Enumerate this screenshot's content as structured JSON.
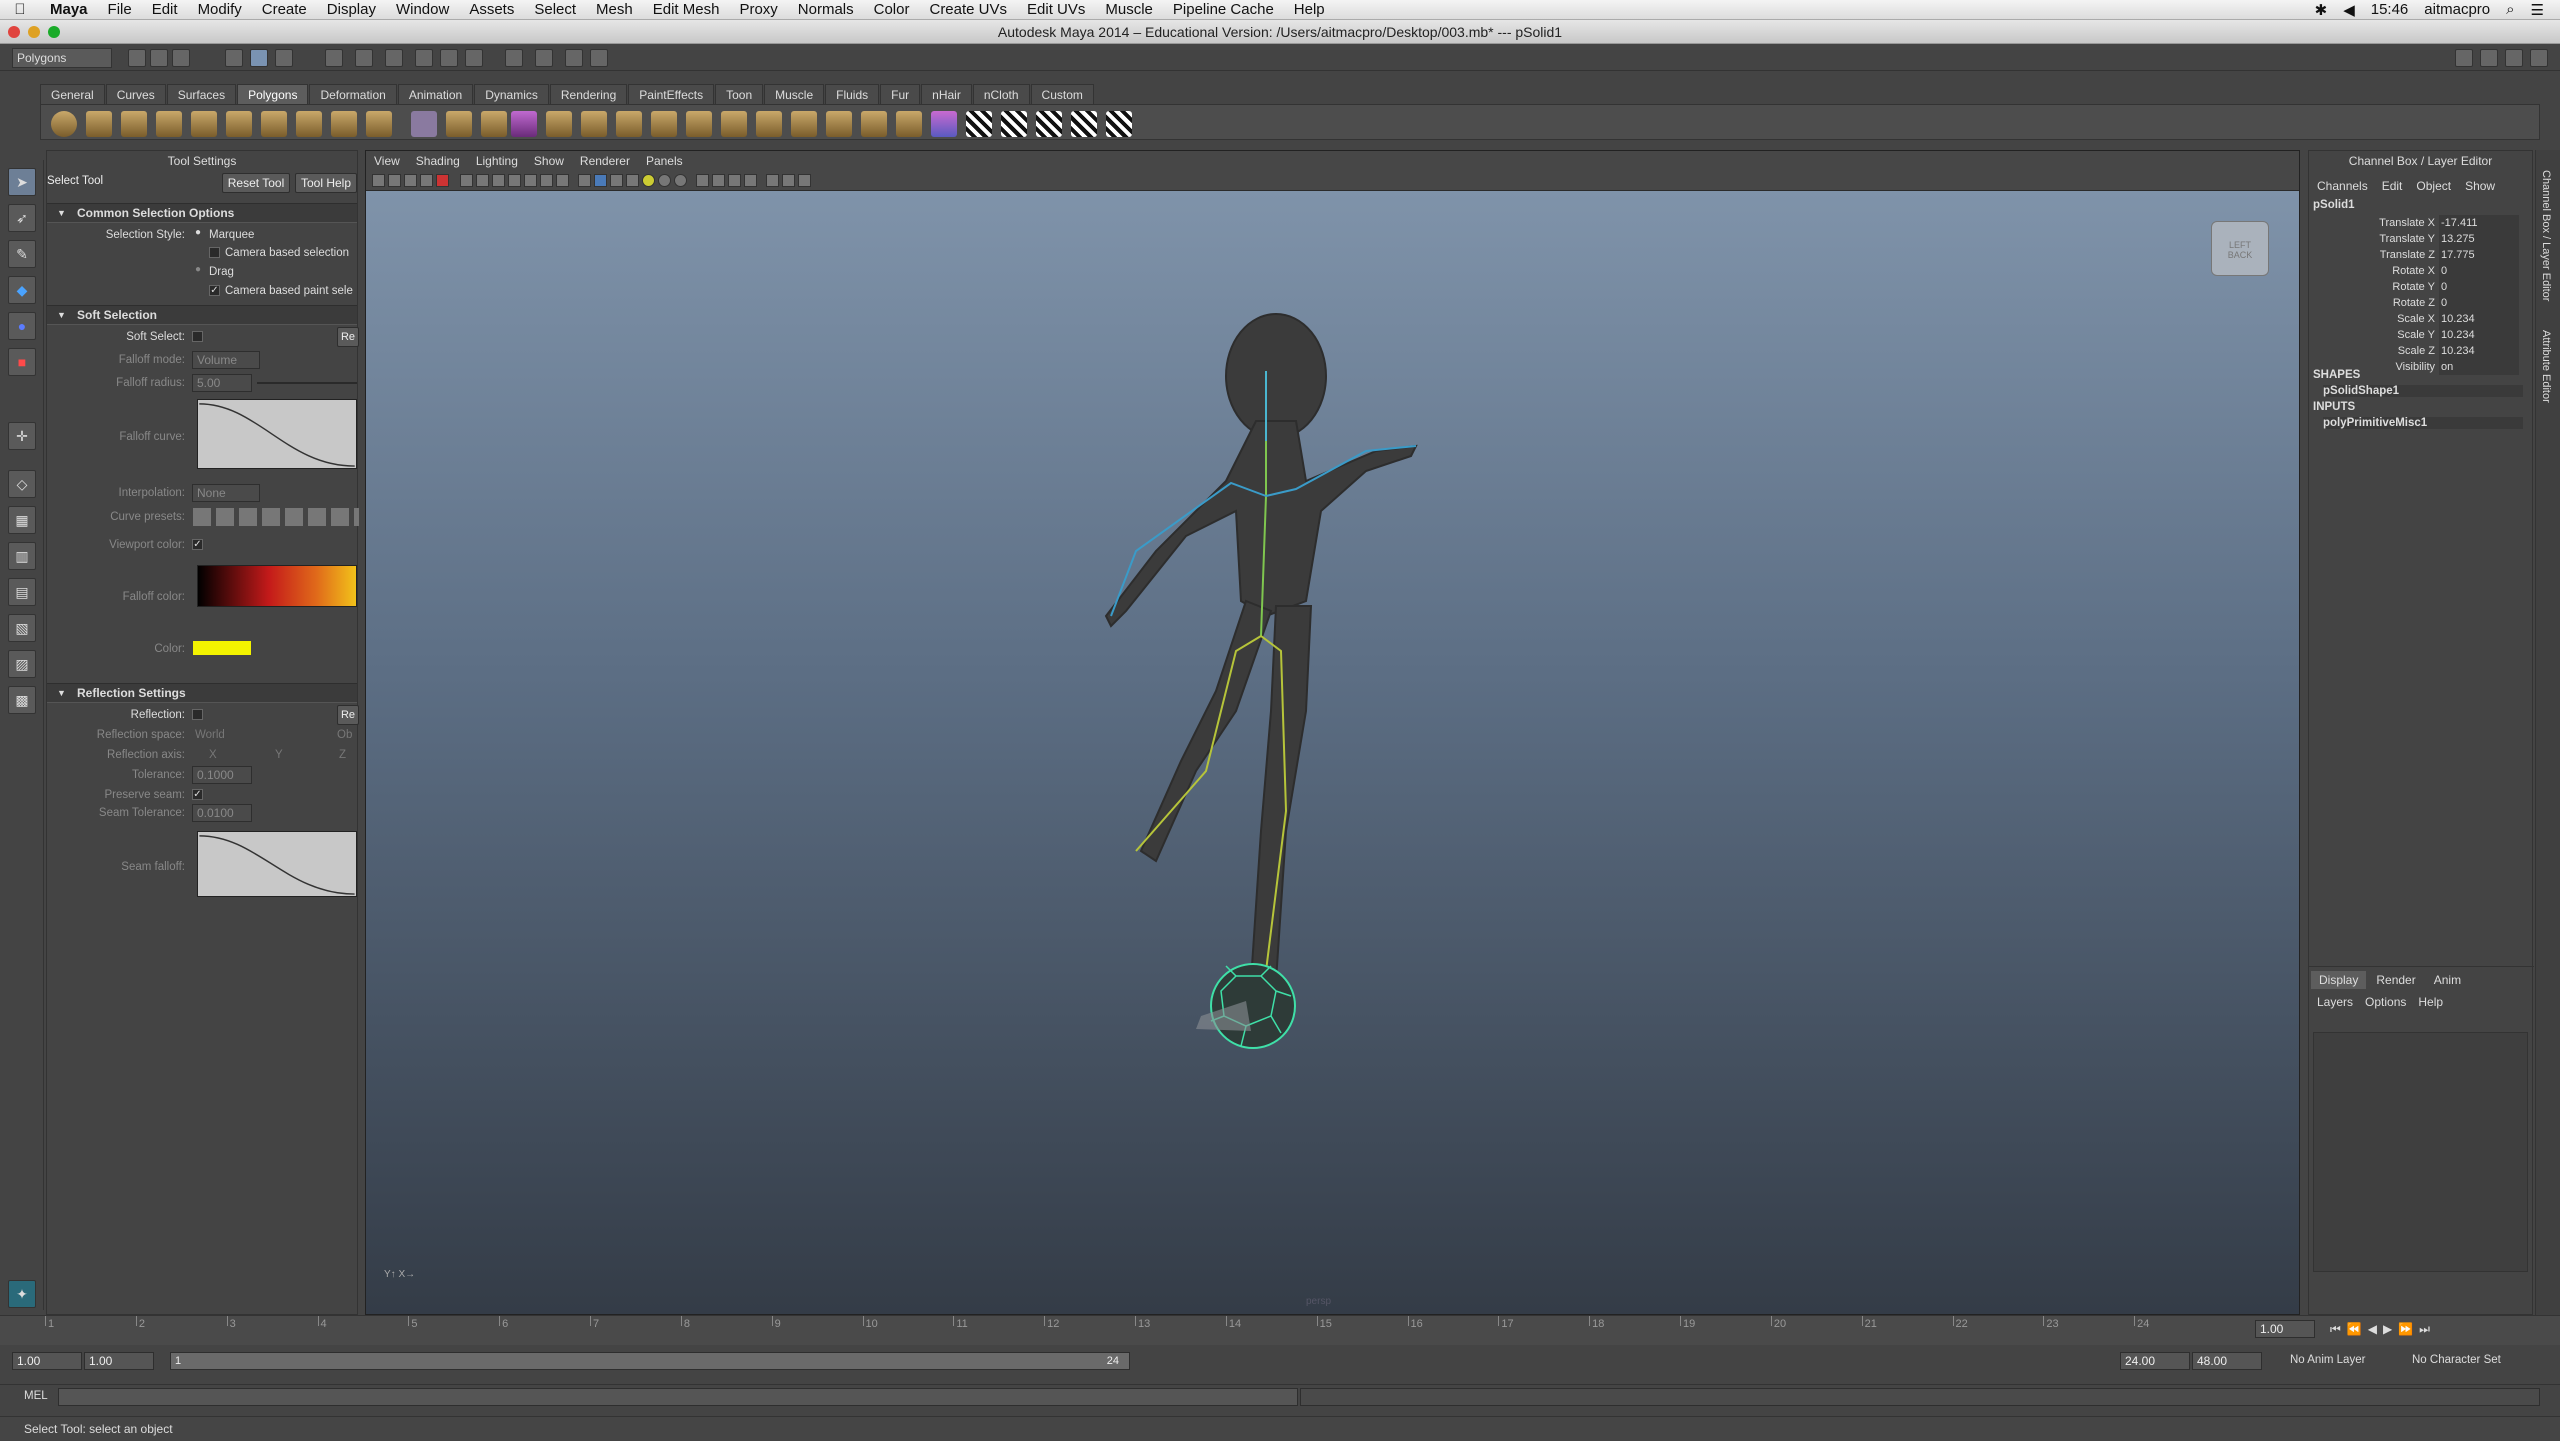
{
  "menubar": {
    "app": "Maya",
    "items": [
      "File",
      "Edit",
      "Modify",
      "Create",
      "Display",
      "Window",
      "Assets",
      "Select",
      "Mesh",
      "Edit Mesh",
      "Proxy",
      "Normals",
      "Color",
      "Create UVs",
      "Edit UVs",
      "Muscle",
      "Pipeline Cache",
      "Help"
    ],
    "clock": "15:46",
    "user": "aitmacpro"
  },
  "window": {
    "title": "Autodesk Maya 2014 – Educational Version: /Users/aitmacpro/Desktop/003.mb*  ---  pSolid1"
  },
  "status_line": {
    "mode": "Polygons"
  },
  "shelf": {
    "tabs": [
      "General",
      "Curves",
      "Surfaces",
      "Polygons",
      "Deformation",
      "Animation",
      "Dynamics",
      "Rendering",
      "PaintEffects",
      "Toon",
      "Muscle",
      "Fluids",
      "Fur",
      "nHair",
      "nCloth",
      "Custom"
    ],
    "active_tab": "Polygons"
  },
  "tool_settings": {
    "panel_title": "Tool Settings",
    "tool_name": "Select Tool",
    "reset_button": "Reset Tool",
    "help_button": "Tool Help",
    "common": {
      "header": "Common Selection Options",
      "style_label": "Selection Style:",
      "marquee": "Marquee",
      "camera_based_selection": "Camera based selection",
      "drag": "Drag",
      "camera_based_paint": "Camera based paint sele"
    },
    "soft": {
      "header": "Soft Selection",
      "soft_select_label": "Soft Select:",
      "reset_short": "Re",
      "falloff_mode_label": "Falloff mode:",
      "falloff_mode_value": "Volume",
      "falloff_radius_label": "Falloff radius:",
      "falloff_radius_value": "5.00",
      "falloff_curve_label": "Falloff curve:",
      "interpolation_label": "Interpolation:",
      "interpolation_value": "None",
      "curve_presets_label": "Curve presets:",
      "viewport_color_label": "Viewport color:",
      "falloff_color_label": "Falloff color:",
      "color_label": "Color:"
    },
    "reflection": {
      "header": "Reflection Settings",
      "reflection_label": "Reflection:",
      "reset_short": "Re",
      "space_label": "Reflection space:",
      "space_world": "World",
      "space_object": "Ob",
      "axis_label": "Reflection axis:",
      "axis_x": "X",
      "axis_y": "Y",
      "axis_z": "Z",
      "tolerance_label": "Tolerance:",
      "tolerance_value": "0.1000",
      "preserve_label": "Preserve seam:",
      "seam_tol_label": "Seam Tolerance:",
      "seam_tol_value": "0.0100",
      "seam_falloff_label": "Seam falloff:"
    }
  },
  "viewport": {
    "menu": [
      "View",
      "Shading",
      "Lighting",
      "Show",
      "Renderer",
      "Panels"
    ],
    "viewcube_left": "LEFT",
    "viewcube_back": "BACK",
    "camera_label": "persp"
  },
  "channel_box": {
    "title": "Channel Box / Layer Editor",
    "menu": [
      "Channels",
      "Edit",
      "Object",
      "Show"
    ],
    "object": "pSolid1",
    "channels": [
      {
        "name": "Translate X",
        "value": "-17.411"
      },
      {
        "name": "Translate Y",
        "value": "13.275"
      },
      {
        "name": "Translate Z",
        "value": "17.775"
      },
      {
        "name": "Rotate X",
        "value": "0"
      },
      {
        "name": "Rotate Y",
        "value": "0"
      },
      {
        "name": "Rotate Z",
        "value": "0"
      },
      {
        "name": "Scale X",
        "value": "10.234"
      },
      {
        "name": "Scale Y",
        "value": "10.234"
      },
      {
        "name": "Scale Z",
        "value": "10.234"
      },
      {
        "name": "Visibility",
        "value": "on"
      }
    ],
    "shapes_label": "SHAPES",
    "shape": "pSolidShape1",
    "inputs_label": "INPUTS",
    "input": "polyPrimitiveMisc1",
    "layer_tabs": [
      "Display",
      "Render",
      "Anim"
    ],
    "layer_menu": [
      "Layers",
      "Options",
      "Help"
    ]
  },
  "side_tabs": {
    "channel": "Channel Box / Layer Editor",
    "attribute": "Attribute Editor"
  },
  "timeline": {
    "ticks": [
      "1",
      "2",
      "3",
      "4",
      "5",
      "6",
      "7",
      "8",
      "9",
      "10",
      "11",
      "12",
      "13",
      "14",
      "15",
      "16",
      "17",
      "18",
      "19",
      "20",
      "21",
      "22",
      "23",
      "24"
    ],
    "current_frame": "1.00"
  },
  "range": {
    "start": "1.00",
    "inner_start": "1.00",
    "slider_start": "1",
    "slider_end": "24",
    "end": "24.00",
    "outer_end": "48.00",
    "anim_layer": "No Anim Layer",
    "character_set": "No Character Set"
  },
  "command": {
    "label": "MEL"
  },
  "help_line": "Select Tool: select an object"
}
